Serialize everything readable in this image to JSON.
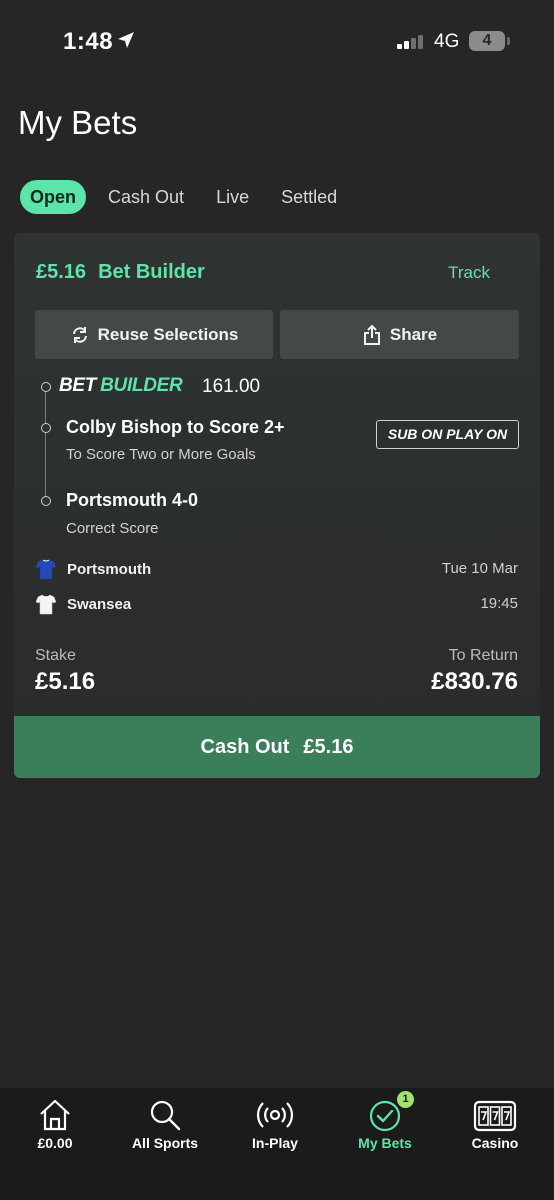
{
  "status_bar": {
    "time": "1:48",
    "network": "4G",
    "battery": "4"
  },
  "page": {
    "title": "My Bets"
  },
  "tabs": [
    {
      "label": "Open",
      "active": true
    },
    {
      "label": "Cash Out",
      "active": false
    },
    {
      "label": "Live",
      "active": false
    },
    {
      "label": "Settled",
      "active": false
    }
  ],
  "bet": {
    "amount": "£5.16",
    "type": "Bet Builder",
    "track_label": "Track",
    "reuse_label": "Reuse Selections",
    "share_label": "Share",
    "bb_logo_part1": "BET",
    "bb_logo_part2": "BUILDER",
    "odds": "161.00",
    "badge": "SUB ON PLAY ON",
    "selections": [
      {
        "title": "Colby Bishop to Score 2+",
        "market": "To Score Two or More Goals"
      },
      {
        "title": "Portsmouth 4-0",
        "market": "Correct Score"
      }
    ],
    "home_team": "Portsmouth",
    "away_team": "Swansea",
    "date": "Tue 10 Mar",
    "time": "19:45",
    "stake_label": "Stake",
    "stake_value": "£5.16",
    "return_label": "To Return",
    "return_value": "£830.76",
    "cashout_label": "Cash Out",
    "cashout_amount": "£5.16"
  },
  "bottom_nav": [
    {
      "label": "£0.00",
      "icon": "home-icon"
    },
    {
      "label": "All Sports",
      "icon": "search-icon"
    },
    {
      "label": "In-Play",
      "icon": "broadcast-icon"
    },
    {
      "label": "My Bets",
      "icon": "check-circle-icon",
      "badge": "1",
      "active": true
    },
    {
      "label": "Casino",
      "icon": "slot-machine-icon"
    }
  ],
  "colors": {
    "accent": "#5de4a8",
    "cashout_bg": "#3a7e5a",
    "background": "#262626",
    "card": "#2e3232",
    "nav_badge": "#9fe36b"
  }
}
